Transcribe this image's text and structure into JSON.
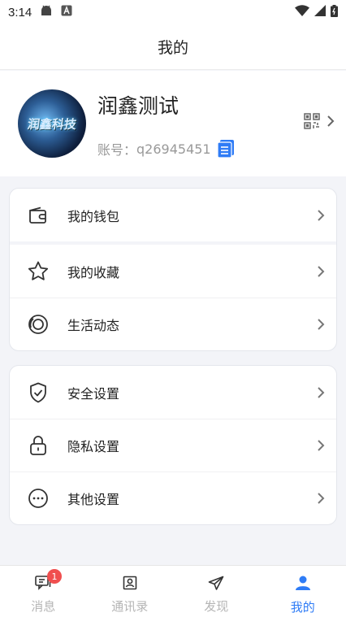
{
  "status_bar": {
    "time": "3:14"
  },
  "header": {
    "title": "我的"
  },
  "profile": {
    "avatar_text": "润鑫科技",
    "name": "润鑫测试",
    "account_label": "账号：",
    "account_id": "q26945451"
  },
  "menu_group_1": [
    {
      "label": "我的钱包",
      "icon": "wallet-icon"
    },
    {
      "label": "我的收藏",
      "icon": "star-icon"
    },
    {
      "label": "生活动态",
      "icon": "moments-icon"
    }
  ],
  "menu_group_2": [
    {
      "label": "安全设置",
      "icon": "shield-icon"
    },
    {
      "label": "隐私设置",
      "icon": "lock-icon"
    },
    {
      "label": "其他设置",
      "icon": "more-icon"
    }
  ],
  "tabbar": {
    "tabs": [
      {
        "label": "消息",
        "icon": "message-icon",
        "badge": "1"
      },
      {
        "label": "通讯录",
        "icon": "contacts-icon"
      },
      {
        "label": "发现",
        "icon": "discover-icon"
      },
      {
        "label": "我的",
        "icon": "profile-icon",
        "active": true
      }
    ]
  },
  "colors": {
    "accent": "#2f7cf6",
    "badge": "#f04f4f",
    "background": "#f3f4f8"
  }
}
